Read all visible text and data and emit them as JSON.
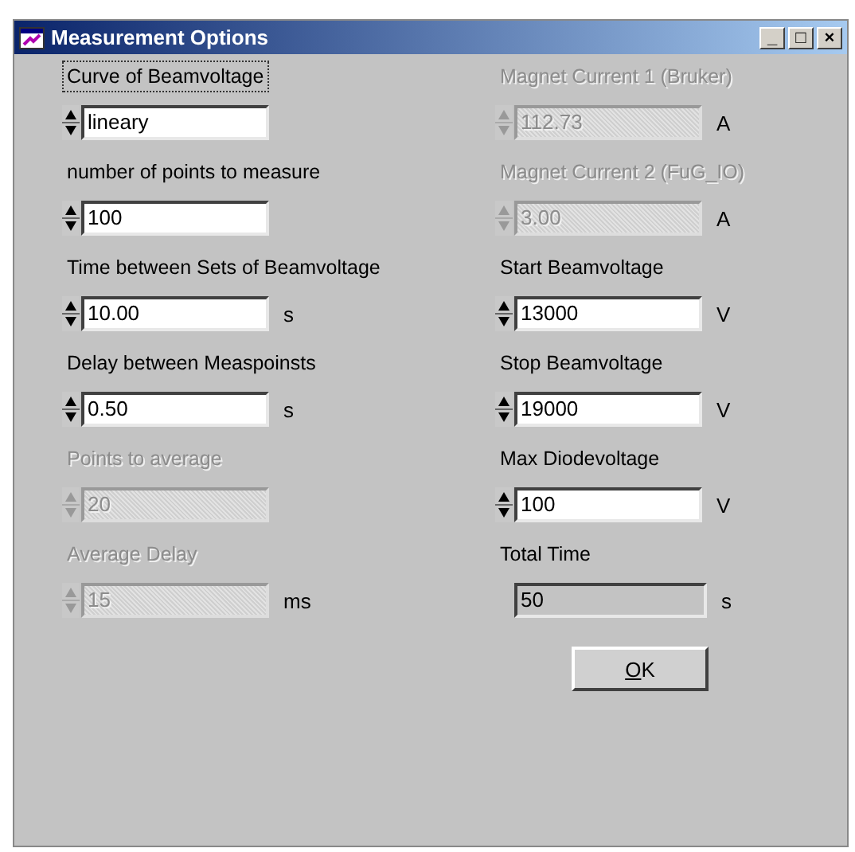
{
  "window": {
    "title": "Measurement Options",
    "controls": [
      "_",
      "□",
      "×"
    ]
  },
  "left": [
    {
      "label": "Curve of Beamvoltage",
      "kind": "spin",
      "value": "lineary",
      "disabled": false,
      "focused": true
    },
    {
      "label": "number of points to measure",
      "kind": "spin",
      "value": "100",
      "disabled": false,
      "focused": false
    },
    {
      "label": "Time between Sets of Beamvoltage",
      "kind": "spin",
      "value": "10.00",
      "unit": "s",
      "disabled": false,
      "focused": false
    },
    {
      "label": "Delay between Measpoinsts",
      "kind": "spin",
      "value": "0.50",
      "unit": "s",
      "disabled": false,
      "focused": false
    },
    {
      "label": "Points to average",
      "kind": "spin",
      "value": "20",
      "disabled": true,
      "focused": false
    },
    {
      "label": "Average Delay",
      "kind": "spin",
      "value": "15",
      "unit": "ms",
      "disabled": true,
      "focused": false
    }
  ],
  "right": [
    {
      "label": "Magnet Current 1 (Bruker)",
      "kind": "spin",
      "value": "112.73",
      "unit": "A",
      "disabled": true,
      "focused": false
    },
    {
      "label": "Magnet Current 2 (FuG_IO)",
      "kind": "spin",
      "value": "3.00",
      "unit": "A",
      "disabled": true,
      "focused": false
    },
    {
      "label": "Start Beamvoltage",
      "kind": "spin",
      "value": "13000",
      "unit": "V",
      "disabled": false,
      "focused": false
    },
    {
      "label": "Stop Beamvoltage",
      "kind": "spin",
      "value": "19000",
      "unit": "V",
      "disabled": false,
      "focused": false
    },
    {
      "label": "Max Diodevoltage",
      "kind": "spin",
      "value": "100",
      "unit": "V",
      "disabled": false,
      "focused": false
    },
    {
      "label": "Total Time",
      "kind": "readout",
      "value": "50",
      "unit": "s",
      "disabled": false,
      "focused": false
    }
  ],
  "ok_button": {
    "label": "OK",
    "mnemonic_underlined": true
  }
}
